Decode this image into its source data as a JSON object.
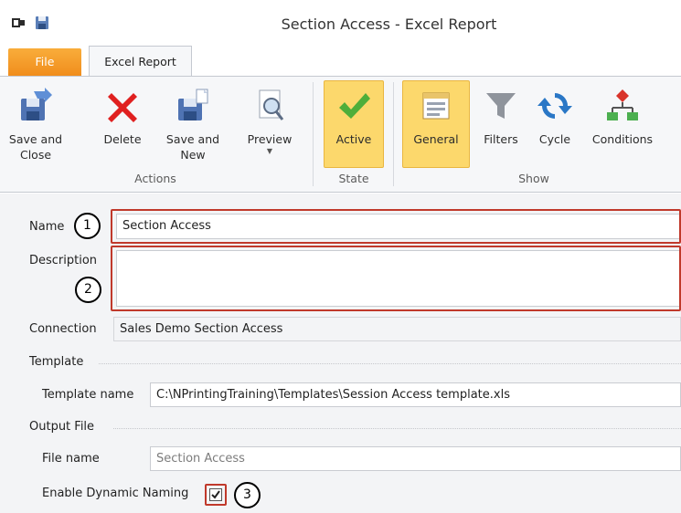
{
  "window": {
    "title": "Section Access - Excel Report"
  },
  "quick_access": {
    "icons": [
      "app-icon",
      "save-icon"
    ]
  },
  "tabs": {
    "file": "File",
    "excel_report": "Excel Report"
  },
  "ribbon": {
    "groups": {
      "actions": "Actions",
      "state": "State",
      "show": "Show"
    },
    "buttons": {
      "save_close": "Save and\nClose",
      "delete": "Delete",
      "save_new": "Save and\nNew",
      "preview": "Preview",
      "active": "Active",
      "general": "General",
      "filters": "Filters",
      "cycle": "Cycle",
      "conditions": "Conditions"
    }
  },
  "form": {
    "name_label": "Name",
    "name_value": "Section Access",
    "description_label": "Description",
    "description_value": "",
    "connection_label": "Connection",
    "connection_value": "Sales Demo Section Access",
    "template_section": "Template",
    "template_name_label": "Template name",
    "template_name_value": "C:\\NPrintingTraining\\Templates\\Session Access template.xls",
    "output_section": "Output File",
    "file_name_label": "File name",
    "file_name_value": "Section Access",
    "dynamic_naming_label": "Enable Dynamic Naming",
    "dynamic_naming_checked": true
  },
  "callouts": [
    "1",
    "2",
    "3"
  ],
  "colors": {
    "file_tab": "#f08c1c",
    "highlight": "#fcd86c",
    "annotation_red": "#c0392b"
  }
}
